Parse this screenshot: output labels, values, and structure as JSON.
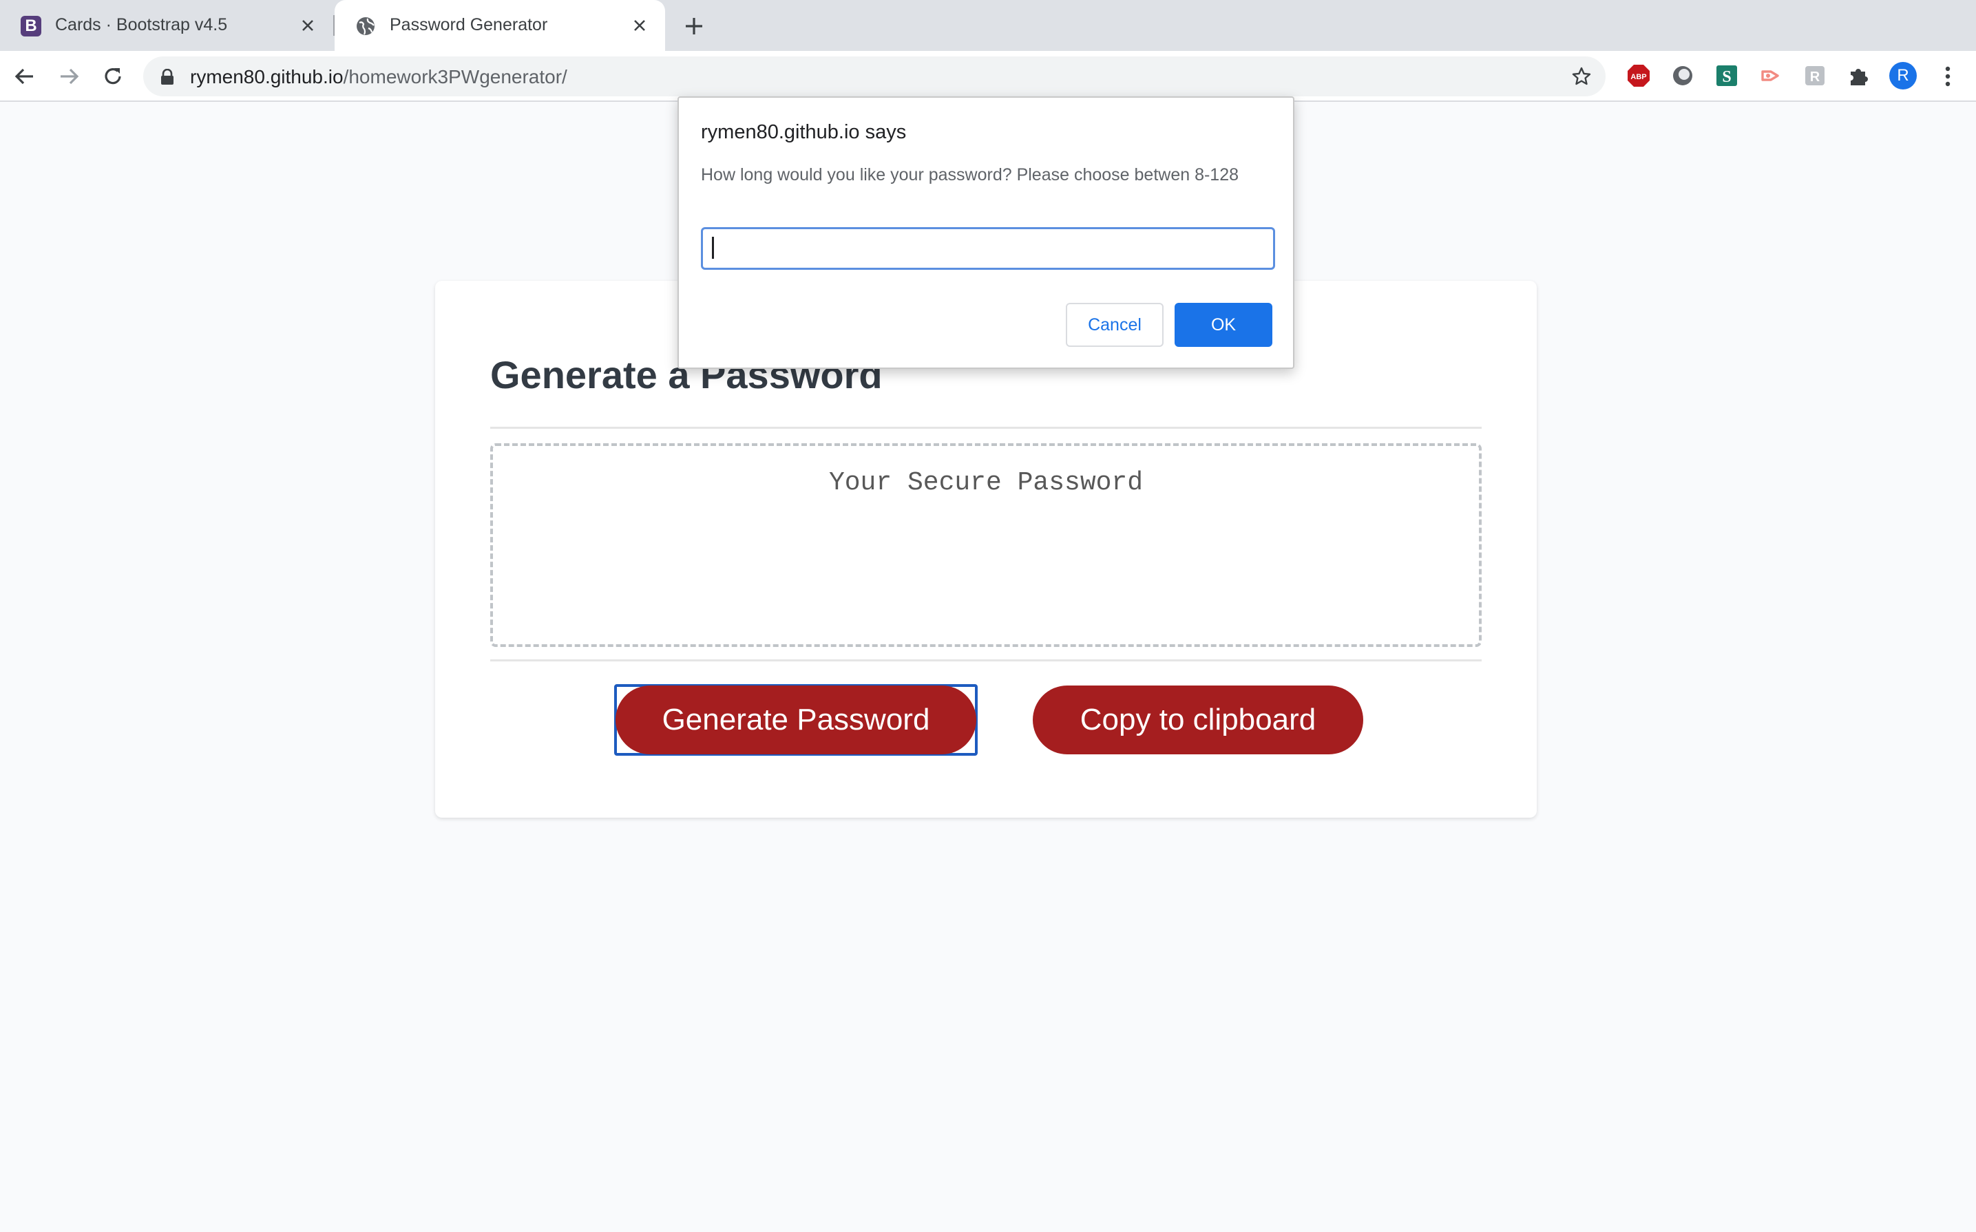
{
  "browser": {
    "tabs": [
      {
        "title": "Cards · Bootstrap v4.5",
        "favicon": "bootstrap-icon",
        "favicon_letter": "B"
      },
      {
        "title": "Password Generator",
        "favicon": "globe-icon"
      }
    ],
    "url": {
      "host": "rymen80.github.io",
      "path": "/homework3PWgenerator/"
    },
    "profile_initial": "R",
    "extensions": [
      "adblock-icon",
      "circle-extension-icon",
      "s-extension-icon",
      "share-extension-icon",
      "r-extension-icon",
      "puzzle-icon"
    ]
  },
  "page": {
    "title": "Generate a Password",
    "password_placeholder": "Your Secure Password",
    "generate_label": "Generate Password",
    "copy_label": "Copy to clipboard",
    "accent_color": "#a51e1f"
  },
  "dialog": {
    "title": "rymen80.github.io says",
    "message": "How long would you like your password? Please choose betwen 8-128",
    "input_value": "",
    "cancel_label": "Cancel",
    "ok_label": "OK"
  }
}
